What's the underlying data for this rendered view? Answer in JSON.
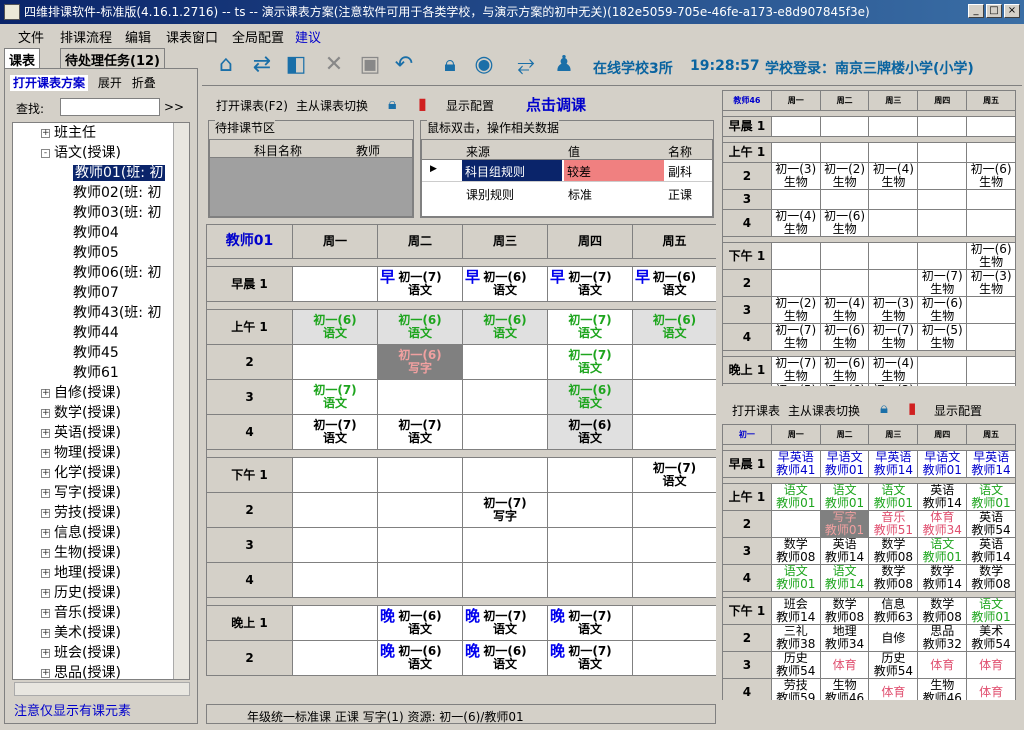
{
  "window": {
    "title": "四维排课软件-标准版(4.16.1.2716) -- ts -- 演示课表方案(注意软件可用于各类学校，与演示方案的初中无关)(182e5059-705e-46fe-a173-e8d907845f3e)",
    "minimize": "_",
    "maximize": "□",
    "close": "×"
  },
  "menu": [
    "文件",
    "排课流程",
    "编辑",
    "课表窗口",
    "全局配置",
    "建议"
  ],
  "left_tabs": [
    "课表",
    "待处理任务(12)"
  ],
  "left_toolbar": {
    "open": "打开课表方案",
    "expand": "展开",
    "collapse": "折叠"
  },
  "search": {
    "label": "查找:",
    "value": "",
    "go": ">>"
  },
  "tree": [
    {
      "label": "班主任",
      "level": 1,
      "exp": "+"
    },
    {
      "label": "语文(授课)",
      "level": 1,
      "exp": "-"
    },
    {
      "label": "教师01(班: 初",
      "level": 2,
      "selected": true
    },
    {
      "label": "教师02(班: 初",
      "level": 2
    },
    {
      "label": "教师03(班: 初",
      "level": 2
    },
    {
      "label": "教师04",
      "level": 2
    },
    {
      "label": "教师05",
      "level": 2
    },
    {
      "label": "教师06(班: 初",
      "level": 2
    },
    {
      "label": "教师07",
      "level": 2
    },
    {
      "label": "教师43(班: 初",
      "level": 2
    },
    {
      "label": "教师44",
      "level": 2
    },
    {
      "label": "教师45",
      "level": 2
    },
    {
      "label": "教师61",
      "level": 2
    },
    {
      "label": "自修(授课)",
      "level": 1,
      "exp": "+"
    },
    {
      "label": "数学(授课)",
      "level": 1,
      "exp": "+"
    },
    {
      "label": "英语(授课)",
      "level": 1,
      "exp": "+"
    },
    {
      "label": "物理(授课)",
      "level": 1,
      "exp": "+"
    },
    {
      "label": "化学(授课)",
      "level": 1,
      "exp": "+"
    },
    {
      "label": "写字(授课)",
      "level": 1,
      "exp": "+"
    },
    {
      "label": "劳技(授课)",
      "level": 1,
      "exp": "+"
    },
    {
      "label": "信息(授课)",
      "level": 1,
      "exp": "+"
    },
    {
      "label": "生物(授课)",
      "level": 1,
      "exp": "+"
    },
    {
      "label": "地理(授课)",
      "level": 1,
      "exp": "+"
    },
    {
      "label": "历史(授课)",
      "level": 1,
      "exp": "+"
    },
    {
      "label": "音乐(授课)",
      "level": 1,
      "exp": "+"
    },
    {
      "label": "美术(授课)",
      "level": 1,
      "exp": "+"
    },
    {
      "label": "班会(授课)",
      "level": 1,
      "exp": "+"
    },
    {
      "label": "思品(授课)",
      "level": 1,
      "exp": "+"
    }
  ],
  "left_status": "注意仅显示有课元素",
  "toolbar": {
    "online": "在线学校3所",
    "time": "19:28:57",
    "login": "学校登录：南京三牌楼小学(小学)"
  },
  "sched_toolbar": {
    "open": "打开课表(F2)",
    "switch": "主从课表切换",
    "config": "显示配置",
    "adjust": "点击调课"
  },
  "pending": {
    "title": "待排课节区",
    "cols": [
      "科目名称",
      "教师"
    ]
  },
  "ops": {
    "title": "鼠标双击，操作相关数据",
    "cols": [
      "来源",
      "值",
      "名称"
    ],
    "rows": [
      [
        "科目组规则",
        "较差",
        "副科"
      ],
      [
        "课别规则",
        "标准",
        "正课"
      ]
    ]
  },
  "main_grid": {
    "corner": "教师01",
    "days": [
      "周一",
      "周二",
      "周三",
      "周四",
      "周五"
    ],
    "sections": [
      {
        "rows": [
          {
            "label": "早晨 1",
            "cells": [
              null,
              {
                "t": "初一(7)",
                "s": "语文",
                "c": "black",
                "m": "早"
              },
              {
                "t": "初一(6)",
                "s": "语文",
                "c": "black",
                "m": "早"
              },
              {
                "t": "初一(7)",
                "s": "语文",
                "c": "black",
                "m": "早"
              },
              {
                "t": "初一(6)",
                "s": "语文",
                "c": "black",
                "m": "早"
              }
            ]
          }
        ]
      },
      {
        "rows": [
          {
            "label": "上午 1",
            "cells": [
              {
                "t": "初一(6)",
                "s": "语文",
                "c": "green",
                "bg": "#e0e0e0"
              },
              {
                "t": "初一(6)",
                "s": "语文",
                "c": "green",
                "bg": "#e0e0e0"
              },
              {
                "t": "初一(6)",
                "s": "语文",
                "c": "green",
                "bg": "#e0e0e0"
              },
              {
                "t": "初一(7)",
                "s": "语文",
                "c": "green"
              },
              {
                "t": "初一(6)",
                "s": "语文",
                "c": "green",
                "bg": "#e0e0e0"
              }
            ]
          },
          {
            "label": "2",
            "cells": [
              null,
              {
                "t": "初一(6)",
                "s": "写字",
                "c": "pink",
                "bg": "#808080"
              },
              null,
              {
                "t": "初一(7)",
                "s": "语文",
                "c": "green"
              },
              null
            ]
          },
          {
            "label": "3",
            "cells": [
              {
                "t": "初一(7)",
                "s": "语文",
                "c": "green"
              },
              null,
              null,
              {
                "t": "初一(6)",
                "s": "语文",
                "c": "green",
                "bg": "#e0e0e0"
              },
              null
            ]
          },
          {
            "label": "4",
            "cells": [
              {
                "t": "初一(7)",
                "s": "语文",
                "c": "black"
              },
              {
                "t": "初一(7)",
                "s": "语文",
                "c": "black"
              },
              null,
              {
                "t": "初一(6)",
                "s": "语文",
                "c": "black",
                "bg": "#e0e0e0"
              },
              null
            ]
          }
        ]
      },
      {
        "rows": [
          {
            "label": "下午 1",
            "cells": [
              null,
              null,
              null,
              null,
              {
                "t": "初一(7)",
                "s": "语文",
                "c": "black"
              }
            ]
          },
          {
            "label": "2",
            "cells": [
              null,
              null,
              {
                "t": "初一(7)",
                "s": "写字",
                "c": "black"
              },
              null,
              null
            ]
          },
          {
            "label": "3",
            "cells": [
              null,
              null,
              null,
              null,
              null
            ]
          },
          {
            "label": "4",
            "cells": [
              null,
              null,
              null,
              null,
              null
            ]
          }
        ]
      },
      {
        "rows": [
          {
            "label": "晚上 1",
            "cells": [
              null,
              {
                "t": "初一(6)",
                "s": "语文",
                "c": "black",
                "m": "晚"
              },
              {
                "t": "初一(7)",
                "s": "语文",
                "c": "black",
                "m": "晚"
              },
              {
                "t": "初一(7)",
                "s": "语文",
                "c": "black",
                "m": "晚"
              },
              null
            ]
          },
          {
            "label": "2",
            "cells": [
              null,
              {
                "t": "初一(6)",
                "s": "语文",
                "c": "black",
                "m": "晚"
              },
              {
                "t": "初一(6)",
                "s": "语文",
                "c": "black",
                "m": "晚"
              },
              {
                "t": "初一(7)",
                "s": "语文",
                "c": "black",
                "m": "晚"
              },
              null
            ]
          }
        ]
      }
    ]
  },
  "status": "年级统一标准课 正课 写字(1) 资源: 初一(6)/教师01",
  "mini1": {
    "corner": "教师46",
    "days": [
      "周一",
      "周二",
      "周三",
      "周四",
      "周五"
    ],
    "sections": [
      [
        [
          "早晨 1",
          "",
          "",
          "",
          "",
          ""
        ]
      ],
      [
        [
          "上午 1",
          "",
          "",
          "",
          "",
          ""
        ],
        [
          "2",
          "初一(3)\n生物",
          "初一(2)\n生物",
          "初一(4)\n生物",
          "",
          "初一(6)\n生物"
        ],
        [
          "3",
          "",
          "",
          "",
          "",
          ""
        ],
        [
          "4",
          "初一(4)\n生物",
          "初一(6)\n生物",
          "",
          "",
          ""
        ]
      ],
      [
        [
          "下午 1",
          "",
          "",
          "",
          "",
          "初一(6)\n生物"
        ],
        [
          "2",
          "",
          "",
          "",
          "初一(7)\n生物",
          "初一(3)\n生物"
        ],
        [
          "3",
          "初一(2)\n生物",
          "初一(4)\n生物",
          "初一(3)\n生物",
          "初一(6)\n生物",
          ""
        ],
        [
          "4",
          "初一(7)\n生物",
          "初一(6)\n生物",
          "初一(7)\n生物",
          "初一(5)\n生物",
          ""
        ]
      ],
      [
        [
          "晚上 1",
          "初一(7)\n生物",
          "初一(6)\n生物",
          "初一(4)\n生物",
          "",
          ""
        ],
        [
          "2",
          "初一(5)\n生物",
          "初一(6)\n生物",
          "初一(3)\n生物",
          "",
          ""
        ]
      ]
    ]
  },
  "mini2_toolbar": {
    "open": "打开课表",
    "switch": "主从课表切换",
    "config": "显示配置"
  },
  "mini2": {
    "corner": "初一",
    "days": [
      "周一",
      "周二",
      "周三",
      "周四",
      "周五"
    ],
    "sections": [
      [
        [
          "早晨 1",
          "早英语\n教师41",
          "早语文\n教师01",
          "早英语\n教师14",
          "早语文\n教师01",
          "早英语\n教师14"
        ]
      ],
      [
        [
          "上午 1",
          "语文\n教师01",
          "语文\n教师01",
          "语文\n教师01",
          "英语\n教师14",
          "语文\n教师01"
        ],
        [
          "2",
          "",
          "写字\n教师01",
          "音乐\n教师51",
          "体育\n教师34",
          "英语\n教师54"
        ],
        [
          "3",
          "数学\n教师08",
          "英语\n教师14",
          "数学\n教师08",
          "语文\n教师01",
          "英语\n教师14"
        ],
        [
          "4",
          "语文\n教师01",
          "语文\n教师14",
          "数学\n教师08",
          "数学\n教师14",
          "数学\n教师08"
        ]
      ],
      [
        [
          "下午 1",
          "班会\n教师14",
          "数学\n教师08",
          "信息\n教师63",
          "数学\n教师08",
          "语文\n教师01"
        ],
        [
          "2",
          "三礼\n教师38",
          "地理\n教师34",
          "自修",
          "思品\n教师32",
          "美术\n教师54"
        ],
        [
          "3",
          "历史\n教师54",
          "体育",
          "历史\n教师54",
          "体育",
          "体育"
        ],
        [
          "4",
          "劳技\n教师59",
          "生物\n教师46",
          "体育",
          "生物\n教师46",
          "体育"
        ]
      ],
      [
        [
          "晚上 1",
          "历史\n教师54",
          "语文\n教师01",
          "数学\n教师08",
          "英语\n教师14",
          "英语\n教师14"
        ],
        [
          "2",
          "英语\n教师14",
          "语文\n教师01",
          "数学\n教师08",
          "英语\n教师14",
          "语文\n教师01"
        ]
      ]
    ]
  }
}
